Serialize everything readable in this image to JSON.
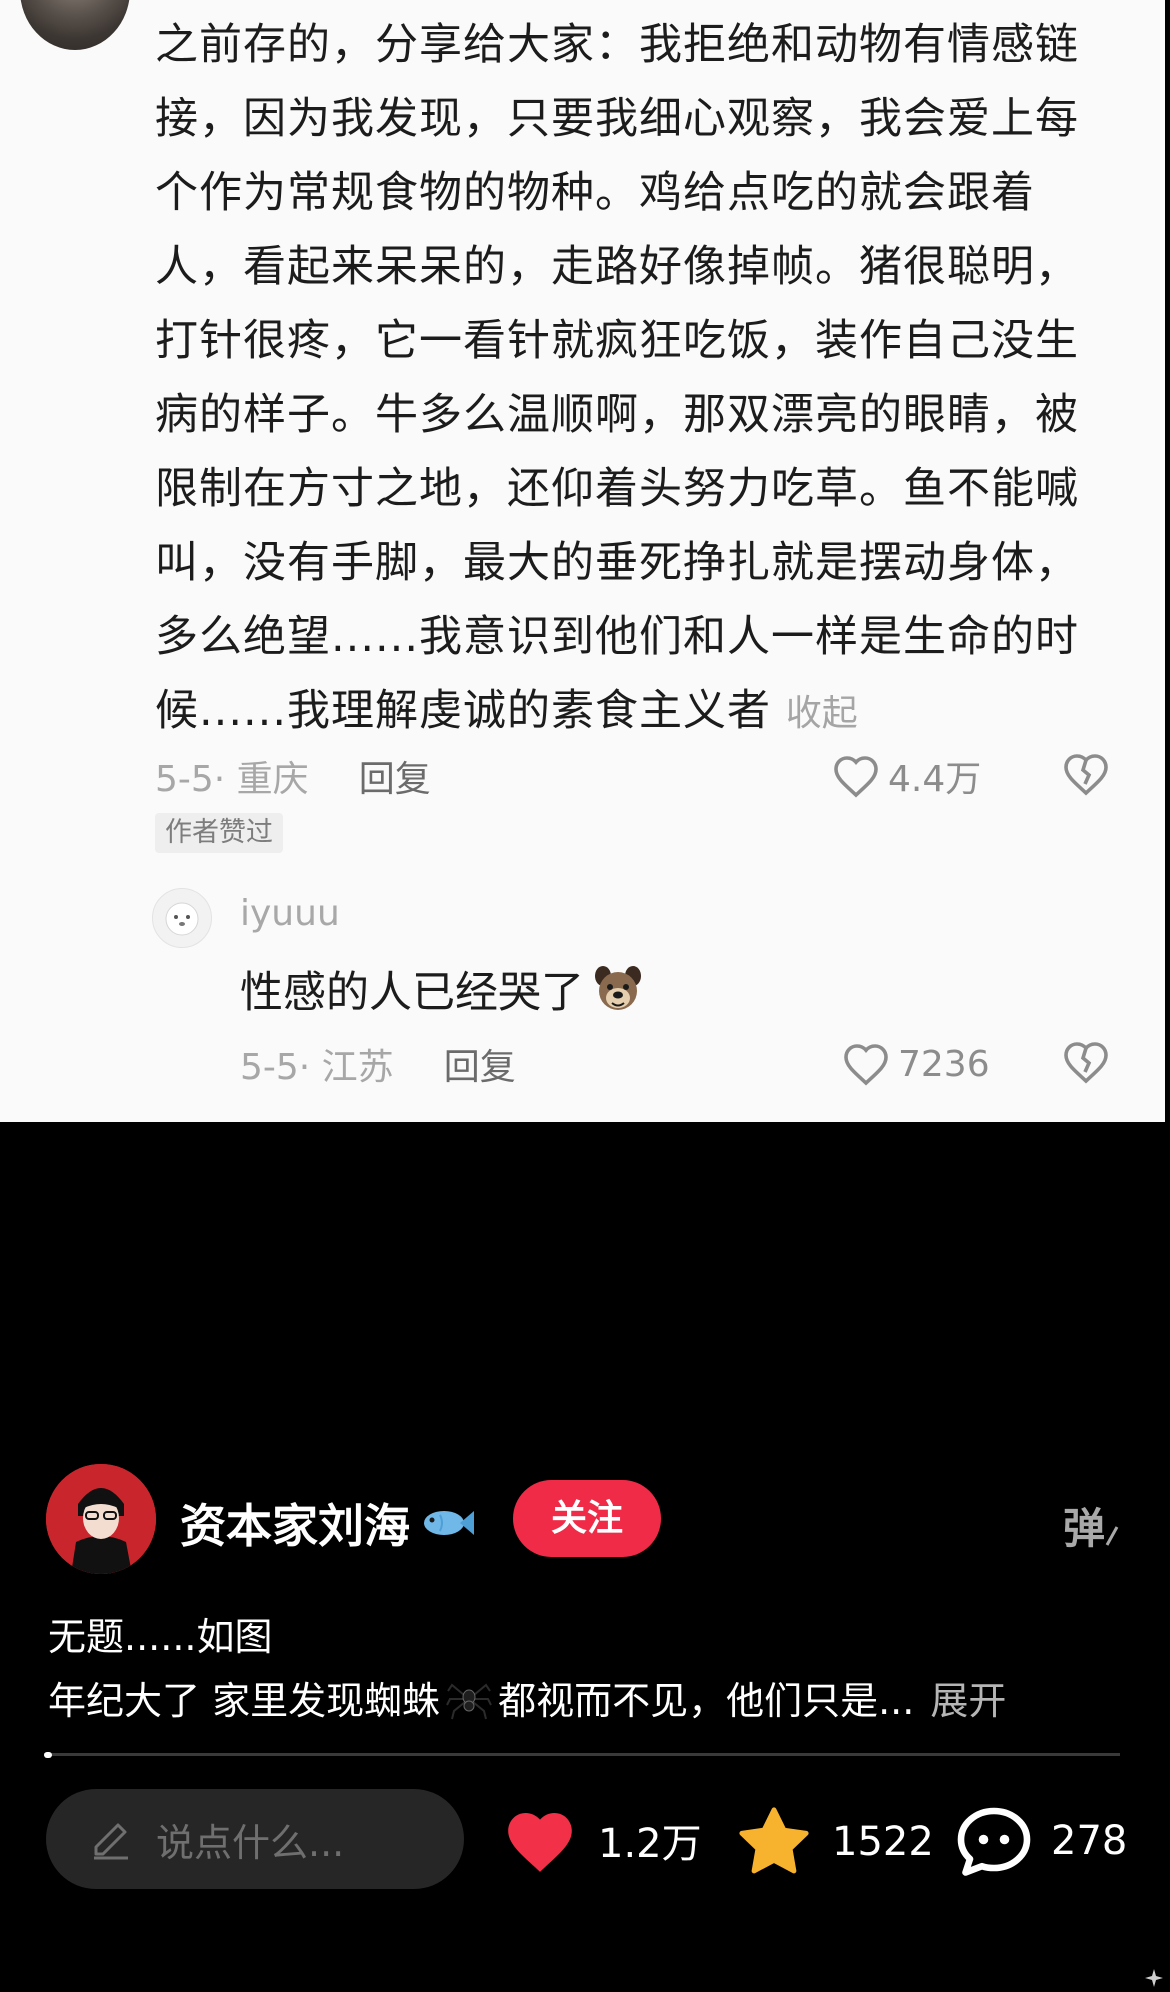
{
  "comment": {
    "text": "之前存的，分享给大家：我拒绝和动物有情感链接，因为我发现，只要我细心观察，我会爱上每个作为常规食物的物种。鸡给点吃的就会跟着人，看起来呆呆的，走路好像掉帧。猪很聪明，打针很疼，它一看针就疯狂吃饭，装作自己没生病的样子。牛多么温顺啊，那双漂亮的眼睛，被限制在方寸之地，还仰着头努力吃草。鱼不能喊叫，没有手脚，最大的垂死挣扎就是摆动身体，多么绝望......我意识到他们和人一样是生命的时候......我理解虔诚的素食主义者",
    "collapse_label": "收起",
    "date_location": "5-5· 重庆",
    "reply_label": "回复",
    "likes": "4.4万",
    "author_liked_badge": "作者赞过"
  },
  "reply": {
    "username": "iyuuu",
    "text": "性感的人已经哭了",
    "date_location": "5-5· 江苏",
    "reply_label": "回复",
    "likes": "7236"
  },
  "post": {
    "author": "资本家刘海",
    "follow_label": "关注",
    "danmu_label": "弹",
    "title": "无题......如图",
    "desc_before": "年纪大了 家里发现蜘蛛",
    "desc_after": "都视而不见，他们只是...",
    "expand_label": "展开",
    "progress": 0.005
  },
  "bottom_bar": {
    "input_placeholder": "说点什么...",
    "like_count": "1.2万",
    "favorite_count": "1522",
    "comment_count": "278"
  },
  "colors": {
    "accent": "#ef2b48",
    "like_heart": "#f23048",
    "star": "#f8b32e"
  },
  "icons": {
    "like": "heart-outline-icon",
    "dislike": "broken-heart-icon",
    "edit": "pencil-icon",
    "comment": "speech-bubble-icon"
  }
}
